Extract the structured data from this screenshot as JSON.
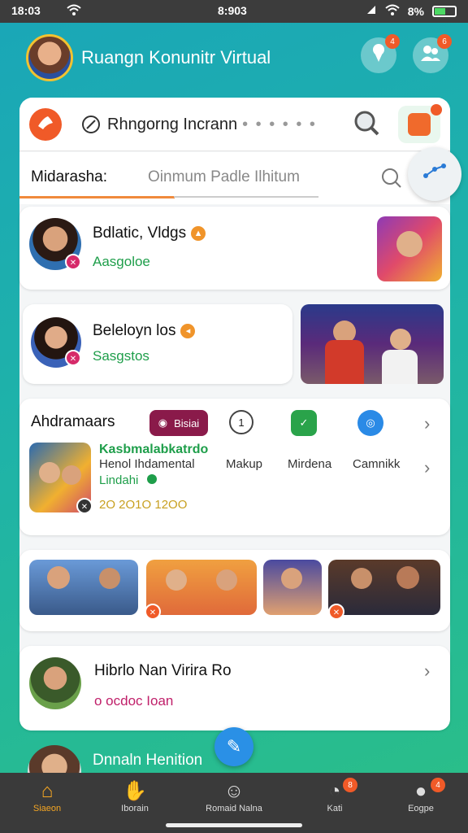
{
  "status_bar": {
    "time_left": "18:03",
    "time_center": "8:903",
    "battery": "8%",
    "battery_level": 0.5
  },
  "header": {
    "title": "Ruangn Konunitr Virtual",
    "icons": [
      "avatar",
      "ice-cream-icon",
      "group-icon"
    ],
    "badges": [
      "4",
      "6"
    ]
  },
  "search": {
    "text": "Rhngorng Incrann",
    "dots": "• • • • • •",
    "icons": [
      "hand-icon",
      "edit-circle-icon",
      "search-icon",
      "app-tile-icon"
    ]
  },
  "tabs": {
    "label": "Midarasha:",
    "input_placeholder": "Oinmum Padle Ilhitum",
    "progress": 0.52
  },
  "cards": {
    "card1": {
      "title": "Bdlatic, Vldgs",
      "subtitle": "Aasgoloe"
    },
    "card2": {
      "title": "Belelоyn los",
      "subtitle": "Sasgstos"
    },
    "card3": {
      "title": "Ahdramaars",
      "chip_label": "Bisiai",
      "chip_number": "1",
      "heading": "Kasbmalabkatrdo",
      "line2": "Henol Ihdamental",
      "line3": "Lindahi",
      "amount": "2O 2O1O 12OO",
      "columns": [
        "Makup",
        "Mirdena",
        "Camnikk"
      ]
    },
    "card5": {
      "title": "Hibrlo Nan Virira Ro",
      "subtitle": "o ocdoc Ioan"
    },
    "next": {
      "title": "Dnnaln Henition"
    }
  },
  "bottom_nav": {
    "items": [
      {
        "label": "Siaeon",
        "icon": "home-icon"
      },
      {
        "label": "Iborain",
        "icon": "hand-icon"
      },
      {
        "label": "Romaid Nalna",
        "icon": "person-icon"
      },
      {
        "label": "Kati",
        "icon": "compass-icon",
        "badge": "8"
      },
      {
        "label": "Eogpe",
        "icon": "profile-icon",
        "badge": "4"
      }
    ]
  },
  "colors": {
    "accent": "#f05a28",
    "green": "#1e9e4a",
    "tab_active": "#f08a3c",
    "nav_active": "#f5a623"
  }
}
